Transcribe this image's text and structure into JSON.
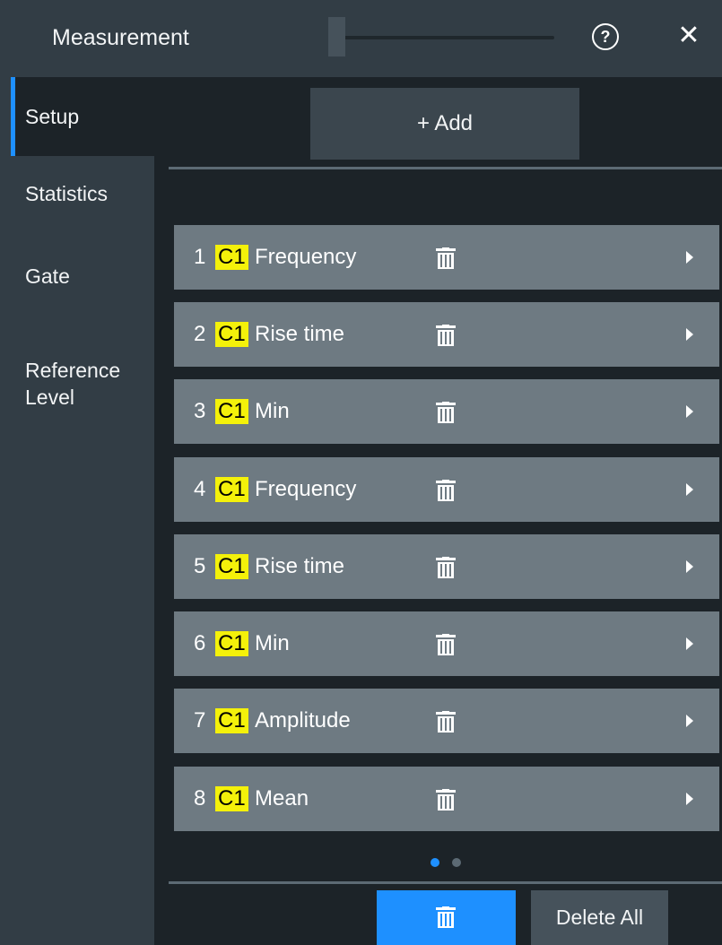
{
  "header": {
    "title": "Measurement",
    "help_icon_glyph": "?",
    "close_icon_glyph": "✕"
  },
  "sidebar": {
    "tabs": [
      {
        "label": "Setup",
        "active": true
      },
      {
        "label": "Statistics",
        "active": false
      },
      {
        "label": "Gate",
        "active": false
      },
      {
        "label": "Reference\nLevel",
        "active": false
      }
    ]
  },
  "main": {
    "add_button_label": "+ Add",
    "measurements": [
      {
        "number": "1",
        "source": "C1",
        "name": "Frequency"
      },
      {
        "number": "2",
        "source": "C1",
        "name": "Rise time"
      },
      {
        "number": "3",
        "source": "C1",
        "name": "Min"
      },
      {
        "number": "4",
        "source": "C1",
        "name": "Frequency"
      },
      {
        "number": "5",
        "source": "C1",
        "name": "Rise time"
      },
      {
        "number": "6",
        "source": "C1",
        "name": "Min"
      },
      {
        "number": "7",
        "source": "C1",
        "name": "Amplitude"
      },
      {
        "number": "8",
        "source": "C1",
        "name": "Mean"
      }
    ],
    "pagination": {
      "pages": 2,
      "current_page": 1
    },
    "delete_all_label": "Delete All"
  },
  "colors": {
    "accent": "#1e90ff",
    "source_badge": "#f4f10a",
    "row_background": "#6e7a82",
    "panel_background": "#1c2328",
    "sidebar_background": "#323d45"
  },
  "icons": {
    "row_action": "trash-icon",
    "row_expand": "arrow-right-icon",
    "header_help": "help-icon",
    "header_close": "close-icon"
  }
}
